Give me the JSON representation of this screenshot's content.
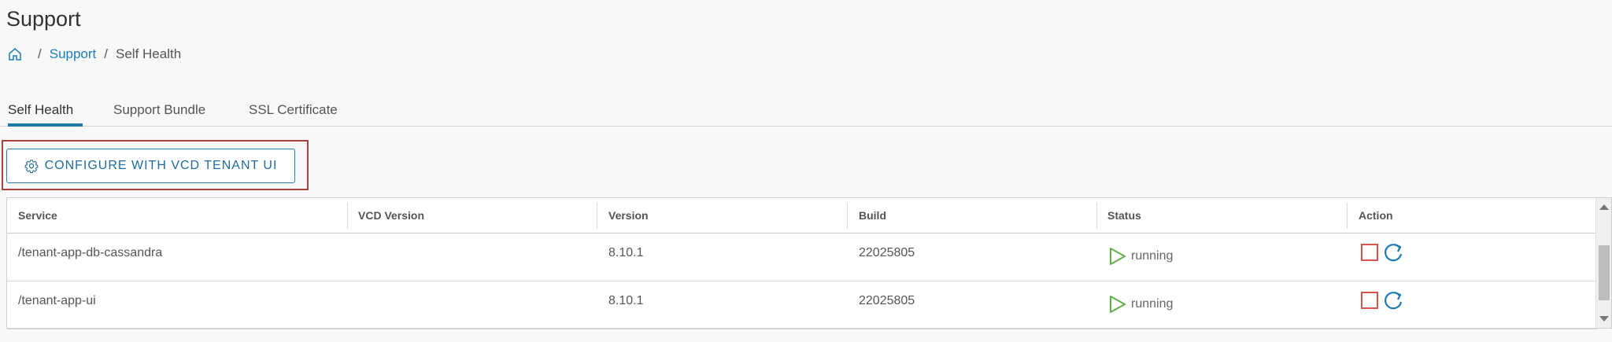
{
  "page": {
    "title": "Support"
  },
  "breadcrumb": {
    "home_icon": "home-icon",
    "items": [
      "Support",
      "Self Health"
    ],
    "separator": "/"
  },
  "tabs": [
    {
      "label": "Self Health",
      "active": true
    },
    {
      "label": "Support Bundle",
      "active": false
    },
    {
      "label": "SSL Certificate",
      "active": false
    }
  ],
  "configure_button": {
    "label": "CONFIGURE WITH VCD TENANT UI",
    "icon": "gear-icon"
  },
  "table": {
    "columns": [
      "Service",
      "VCD Version",
      "Version",
      "Build",
      "Status",
      "Action"
    ],
    "rows": [
      {
        "service": "/tenant-app-db-cassandra",
        "vcd_version": "",
        "version": "8.10.1",
        "build": "22025805",
        "status": "running"
      },
      {
        "service": "/tenant-app-ui",
        "vcd_version": "",
        "version": "8.10.1",
        "build": "22025805",
        "status": "running"
      }
    ]
  },
  "colors": {
    "link": "#1a7fb3",
    "accent": "#1f7ab0",
    "highlight_border": "#a8403f",
    "running_icon": "#5fb04a",
    "stop_icon": "#d9534f",
    "refresh_icon": "#1f7ab0"
  }
}
